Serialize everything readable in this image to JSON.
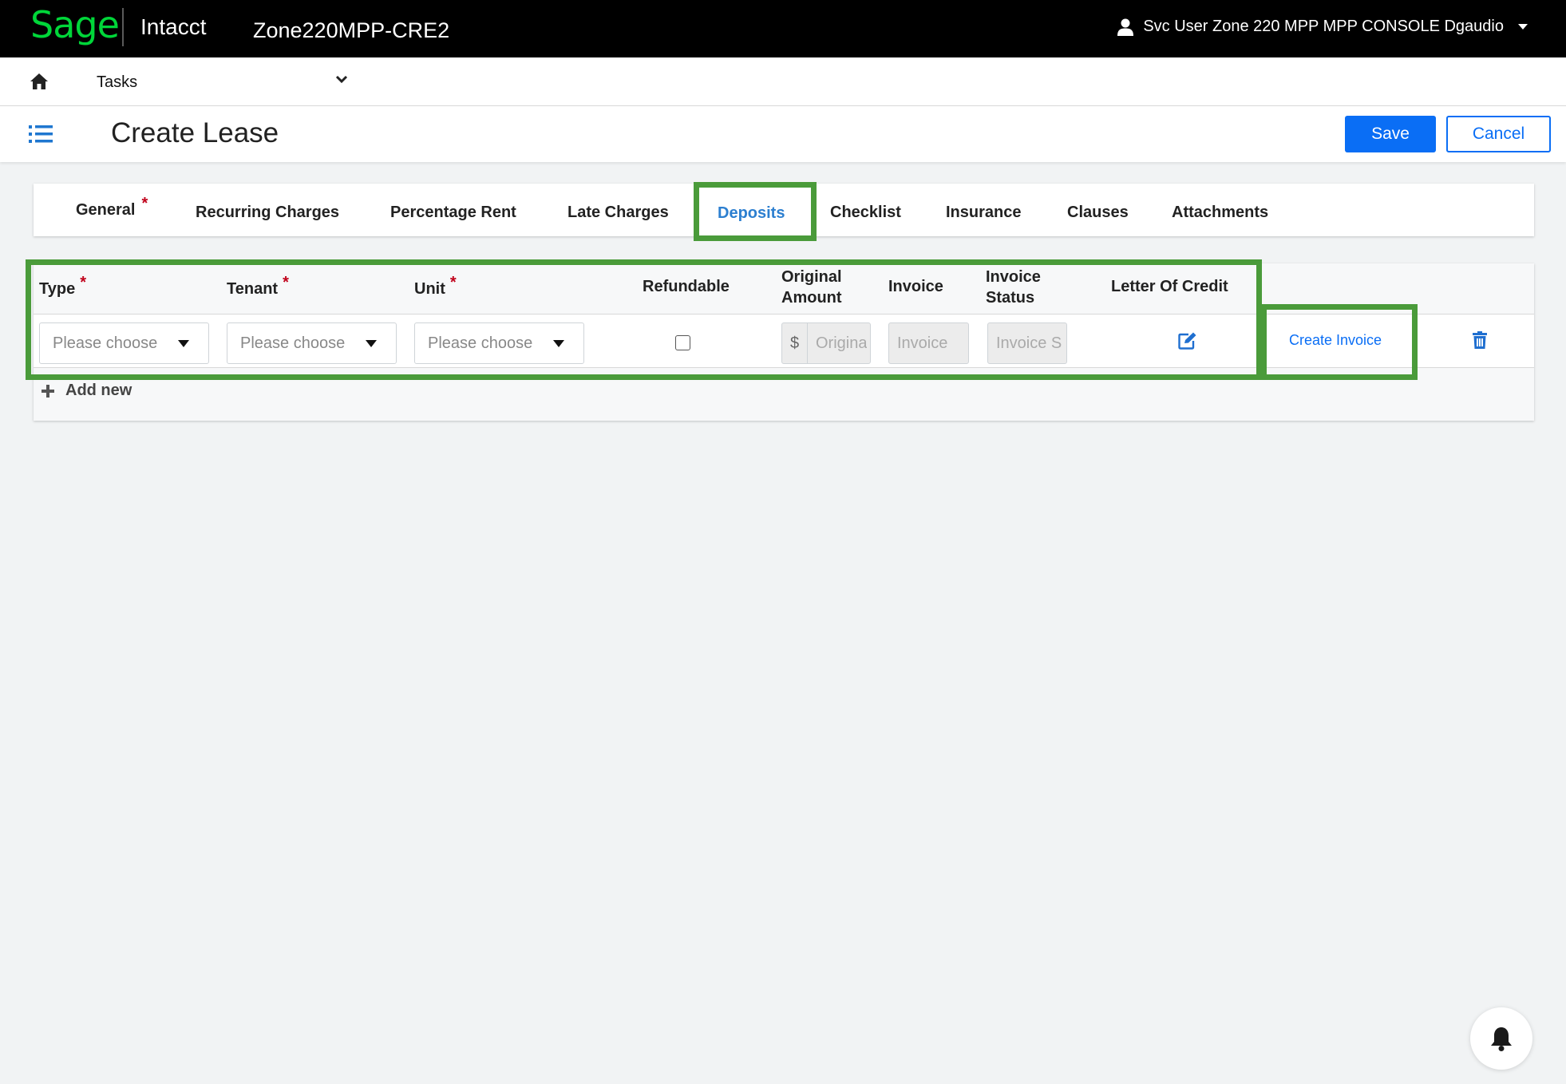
{
  "header": {
    "brand": "Sage",
    "product": "Intacct",
    "company": "Zone220MPP-CRE2",
    "user": "Svc User Zone 220 MPP MPP CONSOLE Dgaudio",
    "brand_color": "#00d639"
  },
  "taskbar": {
    "tasks_label": "Tasks"
  },
  "titlebar": {
    "title": "Create Lease",
    "save_label": "Save",
    "cancel_label": "Cancel"
  },
  "tabs": [
    {
      "label": "General",
      "required": "*"
    },
    {
      "label": "Recurring Charges"
    },
    {
      "label": "Percentage Rent"
    },
    {
      "label": "Late Charges"
    },
    {
      "label": "Deposits",
      "active": true
    },
    {
      "label": "Checklist"
    },
    {
      "label": "Insurance"
    },
    {
      "label": "Clauses"
    },
    {
      "label": "Attachments"
    }
  ],
  "grid": {
    "columns": {
      "type": "Type",
      "tenant": "Tenant",
      "unit": "Unit",
      "refundable": "Refundable",
      "original_amount_line1": "Original",
      "original_amount_line2": "Amount",
      "invoice": "Invoice",
      "invoice_status_line1": "Invoice",
      "invoice_status_line2": "Status",
      "letter_of_credit": "Letter Of Credit",
      "required_mark": "*"
    },
    "row": {
      "type_placeholder": "Please choose",
      "tenant_placeholder": "Please choose",
      "unit_placeholder": "Please choose",
      "currency_symbol": "$",
      "original_amount_placeholder": "Origina",
      "invoice_placeholder": "Invoice",
      "invoice_status_placeholder": "Invoice S",
      "create_invoice_label": "Create Invoice"
    },
    "add_new_label": "Add new"
  },
  "colors": {
    "accent": "#0a6ef5",
    "active_tab": "#2c7fd0",
    "highlight": "#4a9b3a",
    "required": "#c0001a"
  }
}
